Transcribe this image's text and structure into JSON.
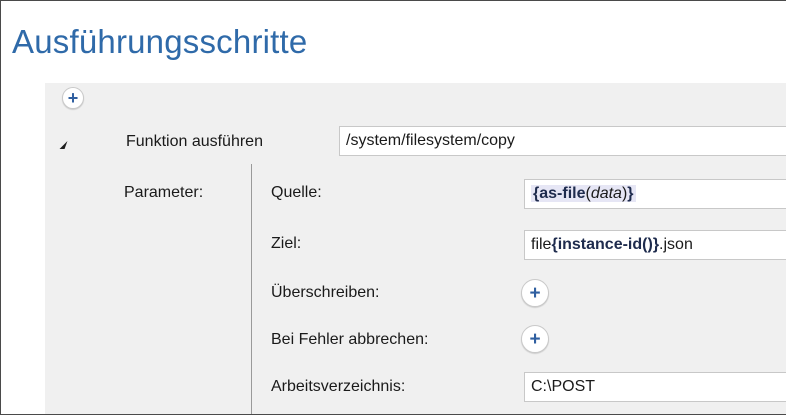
{
  "section": {
    "title": "Ausführungsschritte"
  },
  "step": {
    "function_label": "Funktion ausführen",
    "function_value": "/system/filesystem/copy"
  },
  "parameters": {
    "label": "Parameter:",
    "source": {
      "label": "Quelle:",
      "open": "{",
      "func": "as-file",
      "paren_open": "(",
      "arg": "data",
      "paren_close": ")",
      "close": "}"
    },
    "target": {
      "label": "Ziel:",
      "prefix": "file",
      "open": "{",
      "func": "instance-id",
      "parens": "()",
      "close": "}",
      "suffix": ".json"
    },
    "overwrite": {
      "label": "Überschreiben:"
    },
    "abort_on_error": {
      "label": "Bei Fehler abbrechen:"
    },
    "workdir": {
      "label": "Arbeitsverzeichnis:",
      "value": "C:\\POST"
    }
  },
  "icons": {
    "add": "plus-icon",
    "collapse": "collapse-triangle-icon"
  },
  "colors": {
    "title": "#2f6aa9",
    "plus": "#2f5fa0",
    "panel_bg": "#f0f0f0"
  }
}
